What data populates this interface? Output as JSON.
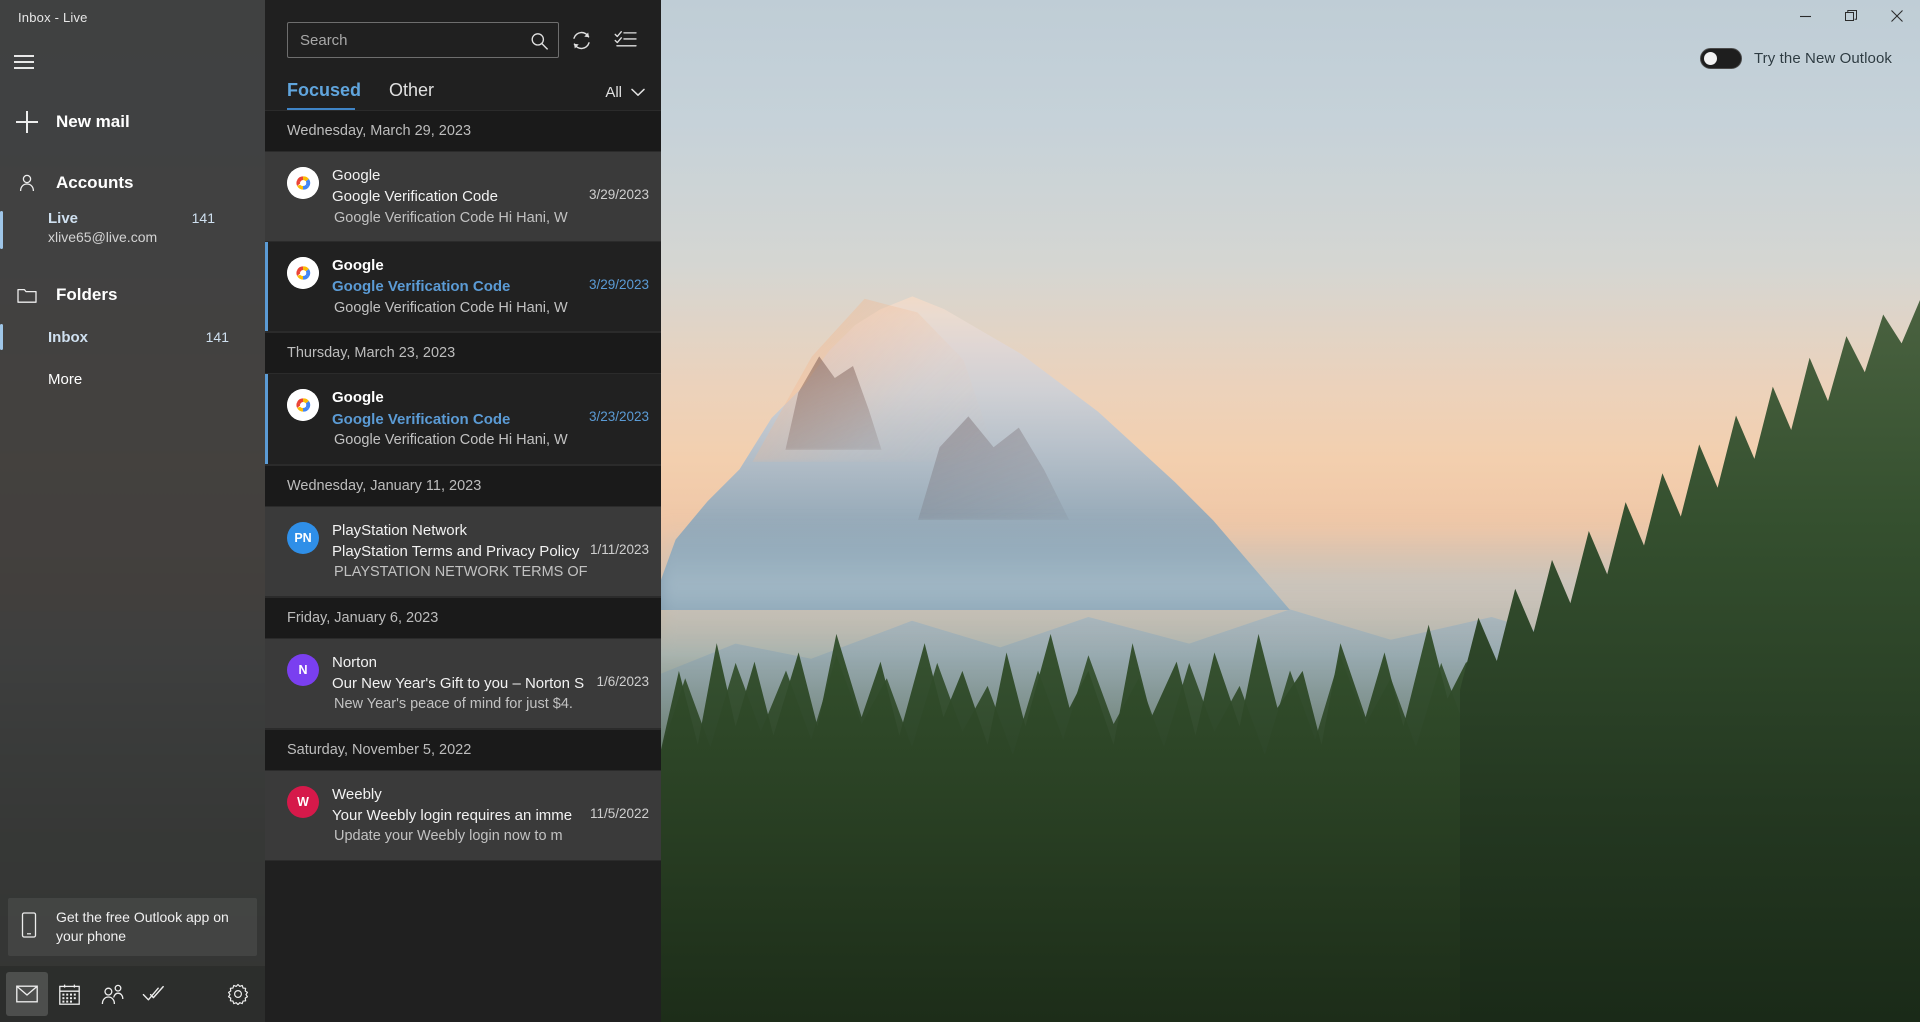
{
  "window": {
    "title": "Inbox - Live",
    "controls": {
      "minimize": "minimize-button",
      "maximize": "maximize-button",
      "close": "close-button"
    }
  },
  "new_outlook": {
    "label": "Try the New Outlook",
    "enabled": false
  },
  "nav": {
    "hamburger": "hamburger-menu",
    "new_mail": "New mail",
    "accounts_label": "Accounts",
    "accounts": [
      {
        "name": "Live",
        "email": "xlive65@live.com",
        "count": "141",
        "selected": true
      }
    ],
    "folders_label": "Folders",
    "folders": [
      {
        "name": "Inbox",
        "count": "141",
        "selected": true
      },
      {
        "name": "More",
        "count": "",
        "selected": false
      }
    ],
    "promo": "Get the free Outlook app on your phone",
    "bottom_bar": [
      {
        "icon": "mail-icon",
        "name": "mail",
        "active": true
      },
      {
        "icon": "calendar-icon",
        "name": "calendar",
        "active": false
      },
      {
        "icon": "people-icon",
        "name": "people",
        "active": false
      },
      {
        "icon": "tasks-icon",
        "name": "tasks",
        "active": false
      },
      {
        "icon": "gear-icon",
        "name": "settings",
        "active": false
      }
    ]
  },
  "list": {
    "search": {
      "placeholder": "Search",
      "value": ""
    },
    "refresh_icon": "sync-icon",
    "select_icon": "select-mode-icon",
    "pivots": [
      {
        "label": "Focused",
        "active": true
      },
      {
        "label": "Other",
        "active": false
      }
    ],
    "filter": {
      "label": "All",
      "icon": "chevron-down-icon"
    },
    "groups": [
      {
        "date": "Wednesday, March 29, 2023",
        "messages": [
          {
            "sender": "Google",
            "subject": "Google Verification Code",
            "preview": "Google Verification Code Hi Hani, W",
            "date": "3/29/2023",
            "unread": false,
            "avatar_type": "google",
            "avatar_initials": "",
            "avatar_color": "#ffffff"
          }
        ]
      },
      {
        "date": "",
        "messages": [
          {
            "sender": "Google",
            "subject": "Google Verification Code",
            "preview": "Google Verification Code Hi Hani, W",
            "date": "3/29/2023",
            "unread": true,
            "avatar_type": "google",
            "avatar_initials": "",
            "avatar_color": "#ffffff"
          }
        ]
      },
      {
        "date": "Thursday, March 23, 2023",
        "messages": [
          {
            "sender": "Google",
            "subject": "Google Verification Code",
            "preview": "Google Verification Code Hi Hani, W",
            "date": "3/23/2023",
            "unread": true,
            "avatar_type": "google",
            "avatar_initials": "",
            "avatar_color": "#ffffff"
          }
        ]
      },
      {
        "date": "Wednesday, January 11, 2023",
        "messages": [
          {
            "sender": "PlayStation Network",
            "subject": "PlayStation Terms and Privacy Policy",
            "preview": "PLAYSTATION NETWORK TERMS OF",
            "date": "1/11/2023",
            "unread": false,
            "avatar_type": "initials",
            "avatar_initials": "PN",
            "avatar_color": "#2f8fe8"
          }
        ]
      },
      {
        "date": "Friday, January 6, 2023",
        "messages": [
          {
            "sender": "Norton",
            "subject": "Our New Year's Gift to you – Norton S",
            "preview": "New Year's peace of mind for just $4.",
            "date": "1/6/2023",
            "unread": false,
            "avatar_type": "initials",
            "avatar_initials": "N",
            "avatar_color": "#7a3ff0"
          }
        ]
      },
      {
        "date": "Saturday, November 5, 2022",
        "messages": [
          {
            "sender": "Weebly",
            "subject": "Your Weebly login requires an imme",
            "preview": "Update your Weebly login now to m",
            "date": "11/5/2022",
            "unread": false,
            "avatar_type": "initials",
            "avatar_initials": "W",
            "avatar_color": "#d6194a"
          }
        ]
      }
    ]
  },
  "colors": {
    "accent": "#5b9bd5",
    "nav_background": "#363636",
    "list_background": "#202020",
    "read_row": "#3a3a3a"
  }
}
